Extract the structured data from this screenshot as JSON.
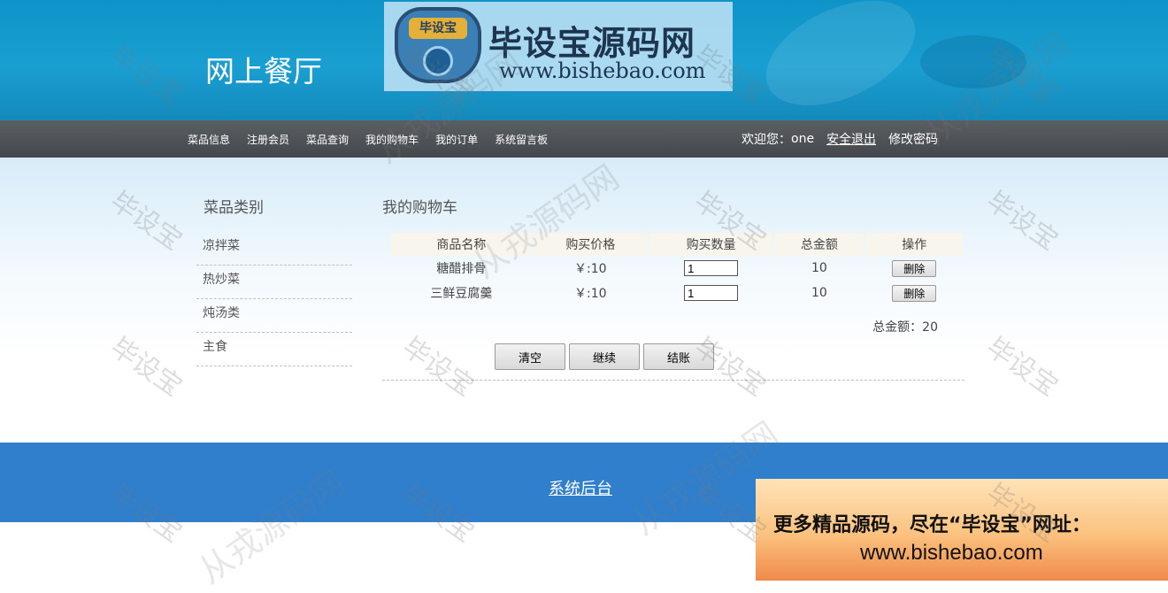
{
  "header": {
    "site_title": "网上餐厅",
    "logo": {
      "badge_text": "毕设宝",
      "name": "毕设宝源码网",
      "url": "www.bishebao.com"
    }
  },
  "nav": {
    "items": [
      "菜品信息",
      "注册会员",
      "菜品查询",
      "我的购物车",
      "我的订单",
      "系统留言板"
    ],
    "welcome_label": "欢迎您：",
    "username": "one",
    "logout": "安全退出",
    "change_password": "修改密码"
  },
  "sidebar": {
    "title": "菜品类别",
    "items": [
      "凉拌菜",
      "热炒菜",
      "炖汤类",
      "主食"
    ]
  },
  "cart": {
    "title": "我的购物车",
    "columns": [
      "商品名称",
      "购买价格",
      "购买数量",
      "总金额",
      "操作"
    ],
    "rows": [
      {
        "name": "糖醋排骨",
        "price": "￥:10",
        "quantity": "1",
        "total": "10",
        "action": "删除"
      },
      {
        "name": "三鲜豆腐羹",
        "price": "￥:10",
        "quantity": "1",
        "total": "10",
        "action": "删除"
      }
    ],
    "grand_total_label": "总金额：",
    "grand_total": "20",
    "buttons": {
      "clear": "清空",
      "continue": "继续",
      "checkout": "结账"
    }
  },
  "footer": {
    "admin_link": "系统后台"
  },
  "ad_banner": {
    "line1": "更多精品源码，尽在“毕设宝”网址：",
    "line2": "www.bishebao.com"
  },
  "watermark": {
    "text_a": "毕设宝",
    "text_b": "从戎源码网"
  },
  "colors": {
    "header": "#1a9fd2",
    "nav": "#4f5357",
    "footer": "#2f7fcd"
  }
}
